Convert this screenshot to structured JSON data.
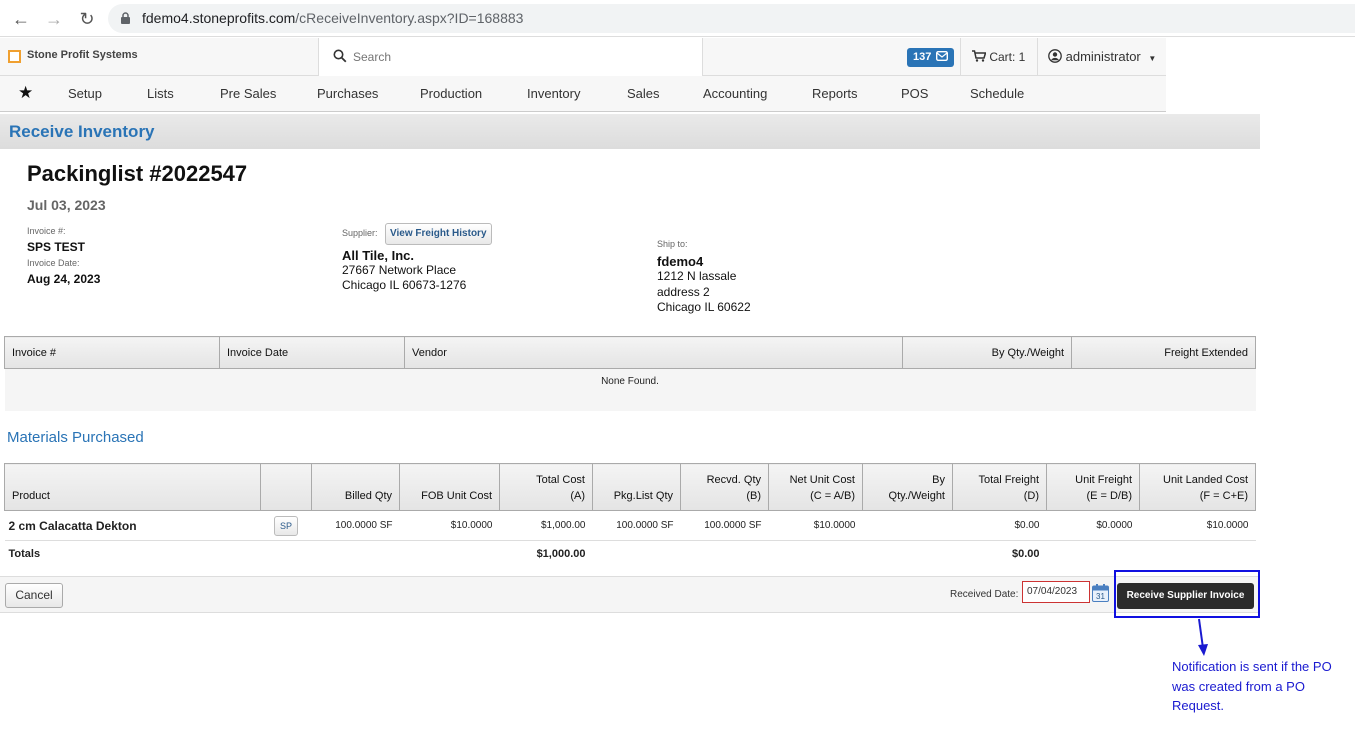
{
  "browser": {
    "url_domain": "fdemo4.stoneprofits.com",
    "url_path": "/cReceiveInventory.aspx?ID=168883"
  },
  "header": {
    "logo_text": "Stone Profit Systems",
    "search_placeholder": "Search",
    "badge_count": "137",
    "cart": "Cart: 1",
    "user": "administrator"
  },
  "menu": [
    "Setup",
    "Lists",
    "Pre Sales",
    "Purchases",
    "Production",
    "Inventory",
    "Sales",
    "Accounting",
    "Reports",
    "POS",
    "Schedule"
  ],
  "page": {
    "title": "Receive Inventory",
    "packinglist": "Packinglist #2022547",
    "date": "Jul 03, 2023",
    "invoice_label": "Invoice #:",
    "invoice_value": "SPS TEST",
    "invoice_date_label": "Invoice Date:",
    "invoice_date_value": "Aug 24, 2023",
    "supplier_label": "Supplier:",
    "freight_button": "View Freight History",
    "supplier_name": "All Tile, Inc.",
    "supplier_addr1": "27667 Network Place",
    "supplier_addr2": "Chicago IL 60673-1276",
    "shipto_label": "Ship to:",
    "shipto_name": "fdemo4",
    "shipto_addr1": "1212 N lassale",
    "shipto_addr2": "address 2",
    "shipto_addr3": "Chicago IL 60622"
  },
  "freight_table": {
    "headers": [
      "Invoice #",
      "Invoice Date",
      "Vendor",
      "By Qty./Weight",
      "Freight Extended"
    ],
    "empty": "None Found."
  },
  "materials": {
    "title": "Materials Purchased",
    "headers": [
      {
        "l1": "",
        "l2": "Product"
      },
      {
        "l1": "",
        "l2": ""
      },
      {
        "l1": "",
        "l2": "Billed Qty"
      },
      {
        "l1": "",
        "l2": "FOB Unit Cost"
      },
      {
        "l1": "Total Cost",
        "l2": "(A)"
      },
      {
        "l1": "",
        "l2": "Pkg.List Qty"
      },
      {
        "l1": "Recvd. Qty",
        "l2": "(B)"
      },
      {
        "l1": "Net Unit Cost",
        "l2": "(C = A/B)"
      },
      {
        "l1": "By",
        "l2": "Qty./Weight"
      },
      {
        "l1": "Total Freight",
        "l2": "(D)"
      },
      {
        "l1": "Unit Freight",
        "l2": "(E = D/B)"
      },
      {
        "l1": "Unit Landed Cost",
        "l2": "(F = C+E)"
      }
    ],
    "row": {
      "product": "2 cm Calacatta Dekton",
      "sp": "SP",
      "billed_qty": "100.0000 SF",
      "fob_unit_cost": "$10.0000",
      "total_cost": "$1,000.00",
      "pkg_qty": "100.0000 SF",
      "recvd_qty": "100.0000 SF",
      "net_unit_cost": "$10.0000",
      "by_qty": "",
      "total_freight": "$0.00",
      "unit_freight": "$0.0000",
      "unit_landed": "$10.0000"
    },
    "totals": {
      "label": "Totals",
      "total_cost": "$1,000.00",
      "total_freight": "$0.00"
    }
  },
  "footer": {
    "cancel": "Cancel",
    "received_label": "Received Date:",
    "received_date": "07/04/2023",
    "receive_button": "Receive Supplier Invoice"
  },
  "annotation": "Notification is sent if the PO was created from a PO Request."
}
